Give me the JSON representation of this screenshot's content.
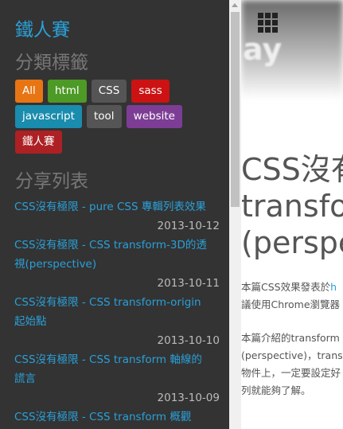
{
  "sidebar": {
    "title": "鐵人賽",
    "category_heading": "分類標籤",
    "tags": [
      {
        "label": "All",
        "color": "#e87513"
      },
      {
        "label": "html",
        "color": "#4d9a26"
      },
      {
        "label": "CSS",
        "color": "#555555"
      },
      {
        "label": "sass",
        "color": "#cc1212"
      },
      {
        "label": "javascript",
        "color": "#1a8cad"
      },
      {
        "label": "tool",
        "color": "#555555"
      },
      {
        "label": "website",
        "color": "#7d3d95"
      },
      {
        "label": "鐵人賽",
        "color": "#ad2024"
      }
    ],
    "share_heading": "分享列表",
    "posts": [
      {
        "title_lines": [
          "CSS沒有極限 - pure CSS 專輯列表效果"
        ],
        "date": "2013-10-12"
      },
      {
        "title_lines": [
          "CSS沒有極限 - CSS transform-3D的透",
          "視(perspective)"
        ],
        "date": "2013-10-11"
      },
      {
        "title_lines": [
          "CSS沒有極限 - CSS transform-origin",
          "起始點"
        ],
        "date": "2013-10-10"
      },
      {
        "title_lines": [
          "CSS沒有極限 - CSS transform 軸線的",
          "謊言"
        ],
        "date": "2013-10-09"
      },
      {
        "title_lines": [
          "CSS沒有極限 - CSS transform 概觀"
        ],
        "date": ""
      }
    ]
  },
  "main": {
    "hero_word": "ay",
    "article_title_lines": [
      "CSS沒有",
      "transfo",
      "(perspe"
    ],
    "paragraph1": {
      "line1_text": "本篇CSS效果發表於",
      "line1_link": "h",
      "line2": "議使用Chrome瀏覽器"
    },
    "paragraph2_lines": [
      "本篇介紹的transform",
      "(perspective)，trans",
      "物件上，一定要設定好",
      "列就能夠了解。"
    ]
  },
  "colors": {
    "accent": "#2aa0d8",
    "sidebar_bg": "#333333"
  }
}
